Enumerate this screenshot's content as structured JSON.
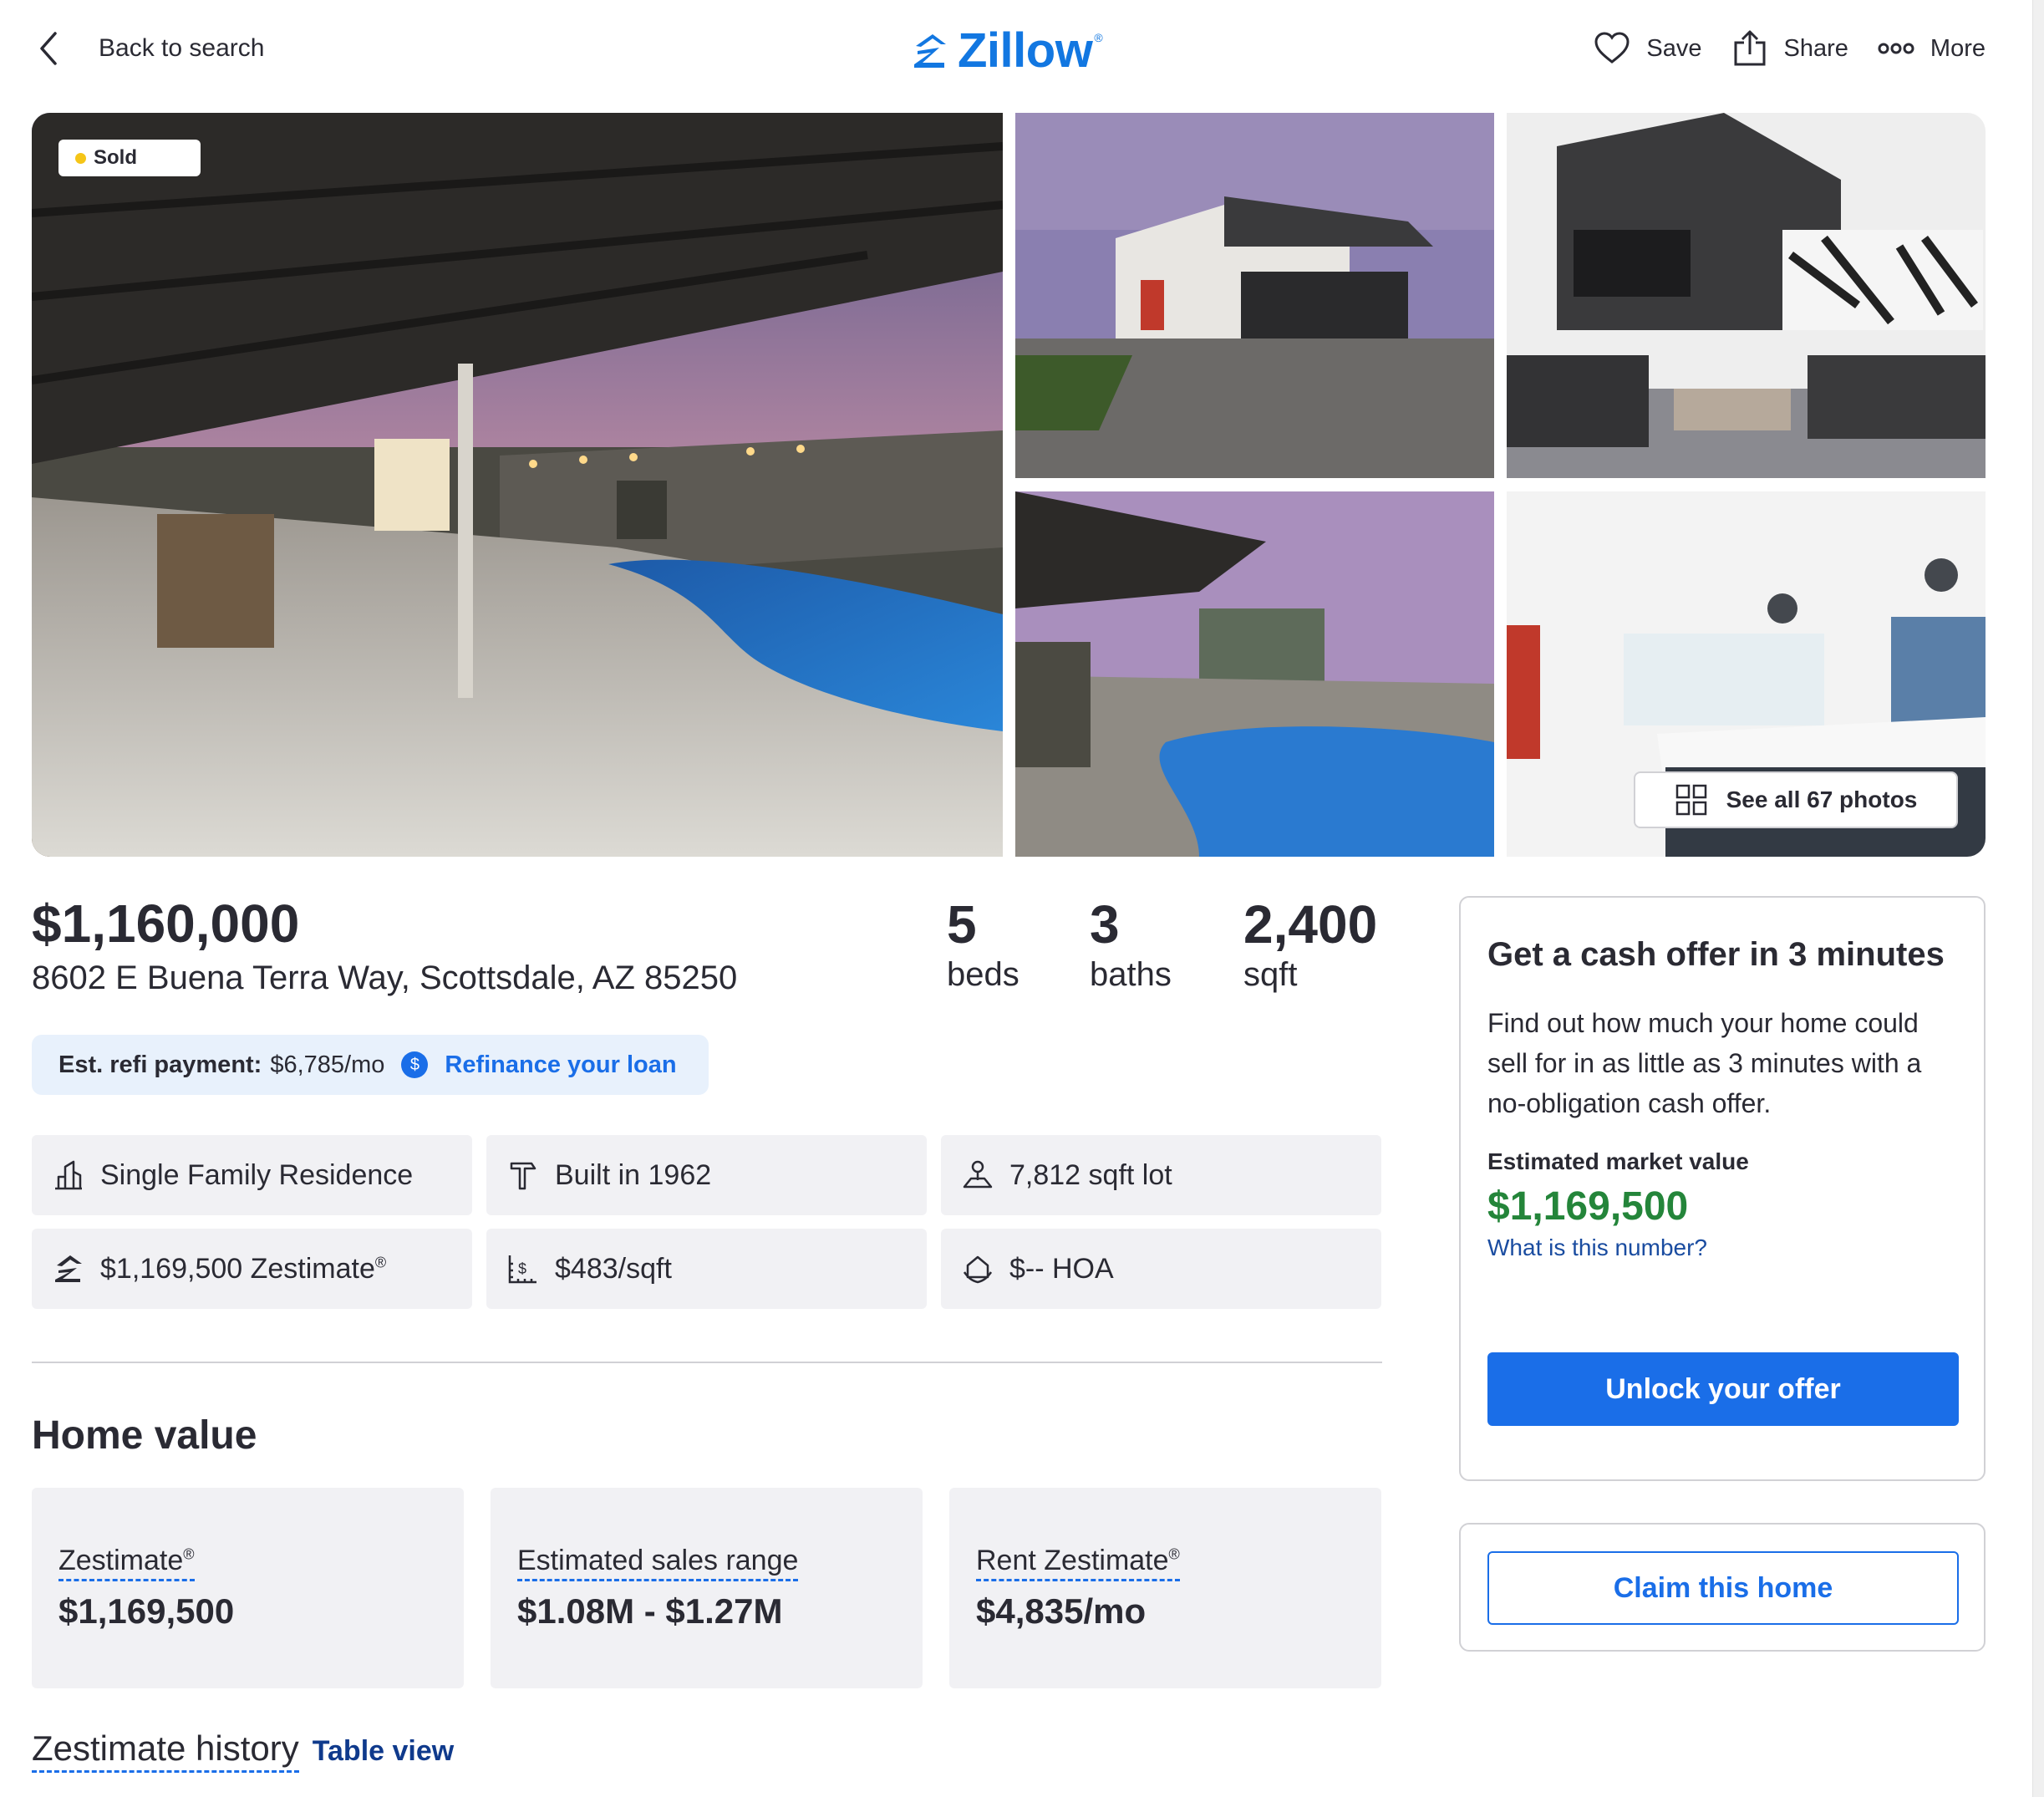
{
  "header": {
    "back_label": "Back to search",
    "logo_text": "Zillow",
    "logo_mark": "®",
    "actions": [
      {
        "label": "Save",
        "icon": "heart-icon"
      },
      {
        "label": "Share",
        "icon": "share-icon"
      },
      {
        "label": "More",
        "icon": "more-dots-icon"
      }
    ]
  },
  "gallery": {
    "status_badge": "Sold",
    "status_color": "#f5c518",
    "see_all_label": "See all 67 photos",
    "photos": [
      {
        "subject": "covered patio with pool at dusk"
      },
      {
        "subject": "front of house with garage"
      },
      {
        "subject": "living room with leather sofas"
      },
      {
        "subject": "backyard pool at dusk"
      },
      {
        "subject": "kitchen with island and pendant lights"
      }
    ]
  },
  "summary": {
    "price": "$1,160,000",
    "address": "8602 E Buena Terra Way, Scottsdale, AZ 85250",
    "beds": {
      "value": "5",
      "label": "beds"
    },
    "baths": {
      "value": "3",
      "label": "baths"
    },
    "sqft": {
      "value": "2,400",
      "label": "sqft"
    }
  },
  "refi": {
    "label": "Est. refi payment:",
    "value": "$6,785/mo",
    "link": "Refinance your loan"
  },
  "facts": {
    "type": "Single Family Residence",
    "built": "Built in 1962",
    "lot": "7,812 sqft lot",
    "zestimate": "$1,169,500 Zestimate",
    "price_per_sqft": "$483/sqft",
    "hoa": "$-- HOA"
  },
  "home_value": {
    "title": "Home value",
    "cards": [
      {
        "label": "Zestimate",
        "value": "$1,169,500"
      },
      {
        "label": "Estimated sales range",
        "value": "$1.08M - $1.27M"
      },
      {
        "label": "Rent Zestimate",
        "value": "$4,835/mo"
      }
    ],
    "history_title": "Zestimate history",
    "table_view": "Table view"
  },
  "offer": {
    "title": "Get a cash offer in 3 minutes",
    "description": "Find out how much your home could sell for in as little as 3 minutes with a no-obligation cash offer.",
    "emv_label": "Estimated market value",
    "emv_value": "$1,169,500",
    "emv_link": "What is this number?",
    "button": "Unlock your offer"
  },
  "claim": {
    "button": "Claim this home"
  },
  "colors": {
    "brand": "#1277e1",
    "accent": "#1a6ee8",
    "value_green": "#24853a"
  }
}
